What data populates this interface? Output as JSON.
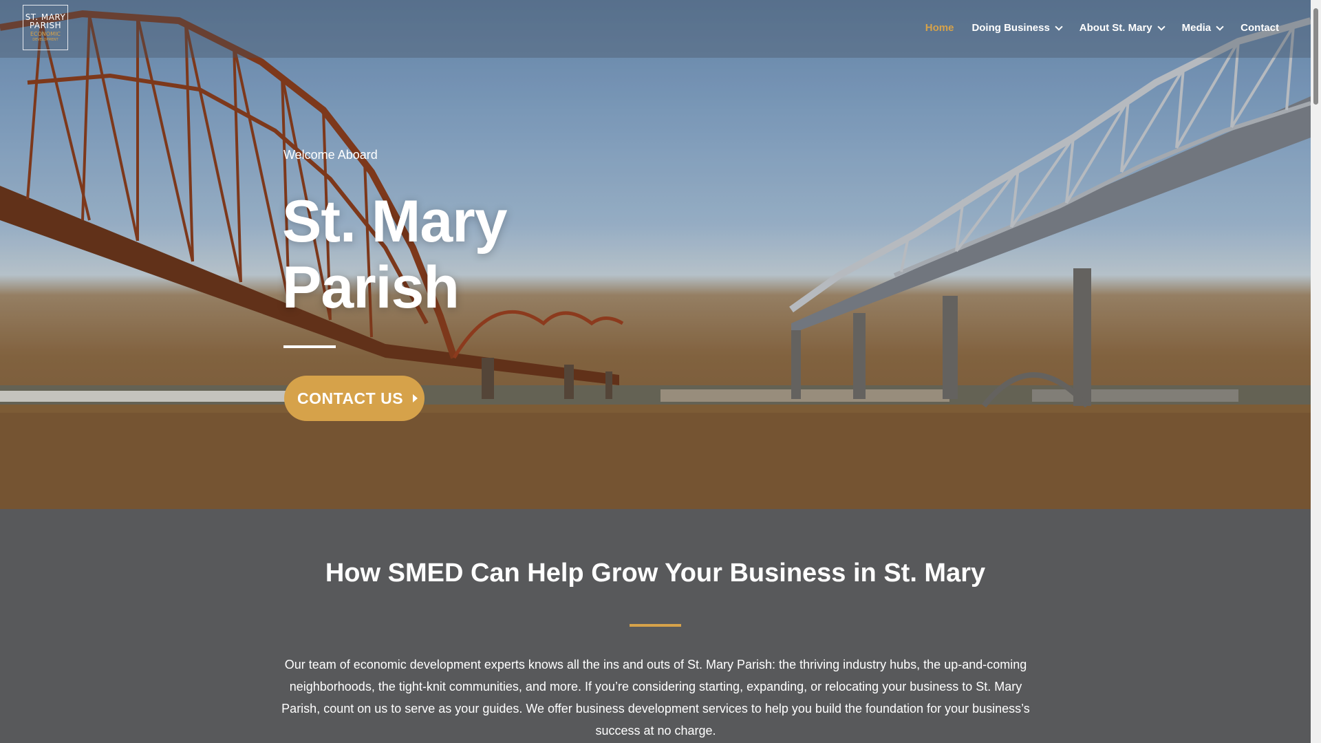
{
  "site": {
    "logo": {
      "line1": "ST. MARY",
      "line2": "PARISH",
      "line3": "ECONOMIC",
      "line4": "DEVELOPMENT"
    },
    "nav": [
      {
        "label": "Home",
        "active": true,
        "has_dropdown": false
      },
      {
        "label": "Doing Business",
        "active": false,
        "has_dropdown": true
      },
      {
        "label": "About St. Mary",
        "active": false,
        "has_dropdown": true
      },
      {
        "label": "Media",
        "active": false,
        "has_dropdown": true
      },
      {
        "label": "Contact",
        "active": false,
        "has_dropdown": false
      }
    ]
  },
  "hero": {
    "eyebrow": "Welcome Aboard",
    "title_line1": "St. Mary",
    "title_line2": "Parish",
    "cta_label": "CONTACT US",
    "background_icon": "bridges-over-river-photo"
  },
  "section": {
    "title": "How SMED Can Help Grow Your Business in St. Mary",
    "body": "Our team of economic development experts knows all the ins and outs of St. Mary Parish: the thriving industry hubs, the up-and-coming neighborhoods, the tight-knit communities, and more. If you’re considering starting, expanding, or relocating your business to St. Mary Parish, count on us to serve as your guides. We offer business development services to help you build the foundation for your business’s success at no charge."
  },
  "colors": {
    "accent": "#d6a24a",
    "section_bg": "#58595b",
    "text": "#ffffff"
  }
}
